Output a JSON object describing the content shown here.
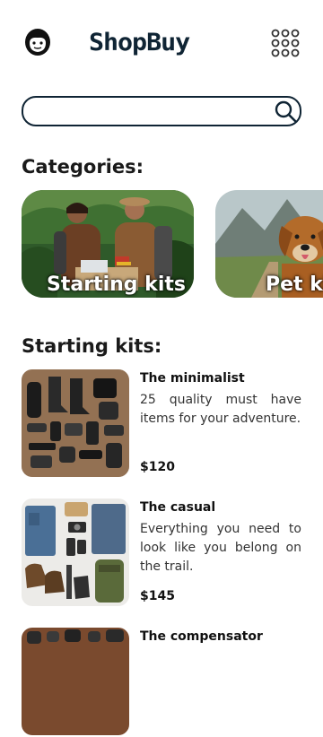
{
  "header": {
    "logo_text": "ShopBuy",
    "icons": {
      "profile": "avatar-icon",
      "menu": "apps-grid-icon"
    }
  },
  "search": {
    "value": "",
    "placeholder": "",
    "icon": "search-icon"
  },
  "categories": {
    "heading": "Categories:",
    "items": [
      {
        "label": "Starting kits"
      },
      {
        "label": "Pet kits"
      }
    ]
  },
  "starting_kits": {
    "heading": "Starting kits:",
    "products": [
      {
        "title": "The minimalist",
        "description": "25 quality must have items for your adventure.",
        "price": "$120"
      },
      {
        "title": "The casual",
        "description": "Everything you need to look like you belong on the trail.",
        "price": "$145"
      },
      {
        "title": "The compensator",
        "description": "",
        "price": ""
      }
    ]
  },
  "colors": {
    "brand": "#0f2434",
    "text": "#1a1a1a"
  }
}
